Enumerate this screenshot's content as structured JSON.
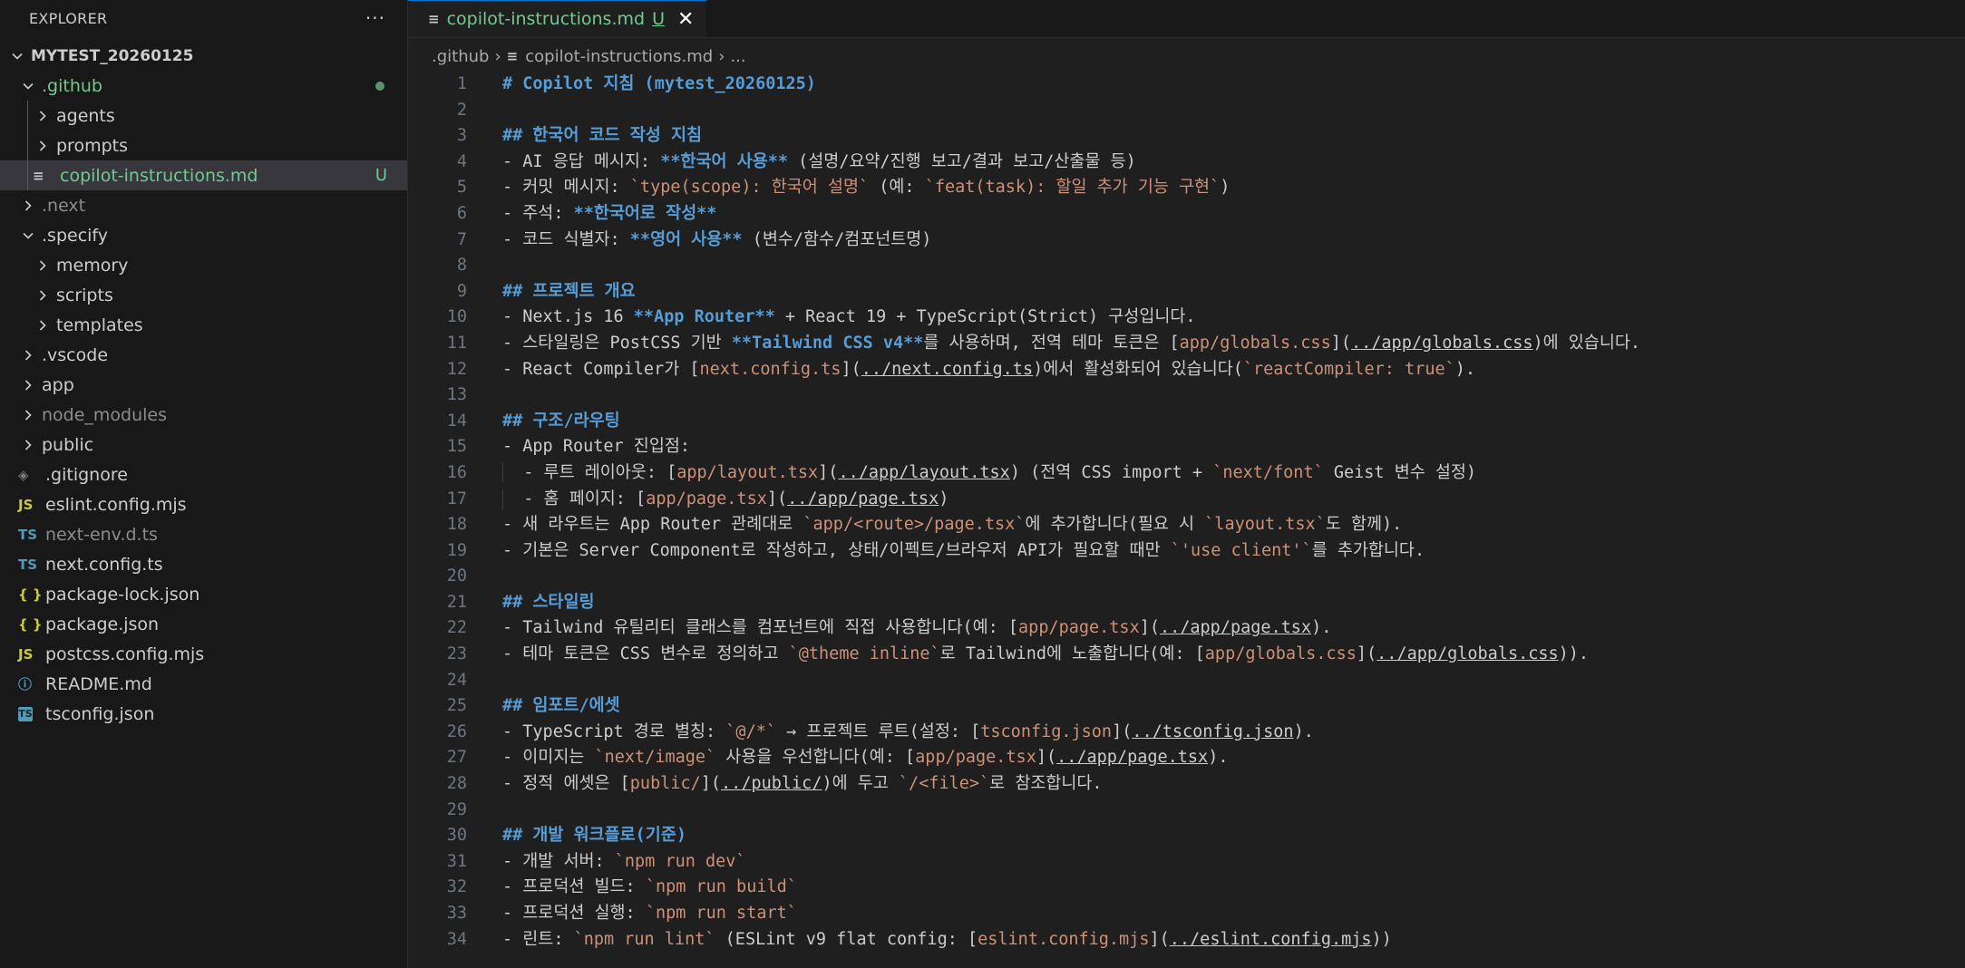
{
  "explorer": {
    "title": "EXPLORER",
    "more": "···",
    "root": "MYTEST_20260125",
    "items": [
      {
        "label": ".github",
        "kind": "folder",
        "open": true,
        "depth": 1,
        "color": "#73c991",
        "badge": "dot"
      },
      {
        "label": "agents",
        "kind": "folder",
        "open": false,
        "depth": 2,
        "color": "#cccccc"
      },
      {
        "label": "prompts",
        "kind": "folder",
        "open": false,
        "depth": 2,
        "color": "#cccccc"
      },
      {
        "label": "copilot-instructions.md",
        "kind": "file",
        "icon": "md",
        "depth": 2,
        "color": "#73c991",
        "badge": "U",
        "selected": true
      },
      {
        "label": ".next",
        "kind": "folder",
        "open": false,
        "depth": 1,
        "color": "#8c8c8c"
      },
      {
        "label": ".specify",
        "kind": "folder",
        "open": true,
        "depth": 1,
        "color": "#cccccc"
      },
      {
        "label": "memory",
        "kind": "folder",
        "open": false,
        "depth": 2,
        "color": "#cccccc"
      },
      {
        "label": "scripts",
        "kind": "folder",
        "open": false,
        "depth": 2,
        "color": "#cccccc"
      },
      {
        "label": "templates",
        "kind": "folder",
        "open": false,
        "depth": 2,
        "color": "#cccccc"
      },
      {
        "label": ".vscode",
        "kind": "folder",
        "open": false,
        "depth": 1,
        "color": "#cccccc"
      },
      {
        "label": "app",
        "kind": "folder",
        "open": false,
        "depth": 1,
        "color": "#cccccc"
      },
      {
        "label": "node_modules",
        "kind": "folder",
        "open": false,
        "depth": 1,
        "color": "#8c8c8c"
      },
      {
        "label": "public",
        "kind": "folder",
        "open": false,
        "depth": 1,
        "color": "#cccccc"
      },
      {
        "label": ".gitignore",
        "kind": "file",
        "icon": "git",
        "depth": 1,
        "color": "#cccccc"
      },
      {
        "label": "eslint.config.mjs",
        "kind": "file",
        "icon": "js",
        "depth": 1,
        "color": "#cccccc"
      },
      {
        "label": "next-env.d.ts",
        "kind": "file",
        "icon": "ts",
        "depth": 1,
        "color": "#8c8c8c"
      },
      {
        "label": "next.config.ts",
        "kind": "file",
        "icon": "ts",
        "depth": 1,
        "color": "#cccccc"
      },
      {
        "label": "package-lock.json",
        "kind": "file",
        "icon": "json",
        "depth": 1,
        "color": "#cccccc"
      },
      {
        "label": "package.json",
        "kind": "file",
        "icon": "json",
        "depth": 1,
        "color": "#cccccc"
      },
      {
        "label": "postcss.config.mjs",
        "kind": "file",
        "icon": "js",
        "depth": 1,
        "color": "#cccccc"
      },
      {
        "label": "README.md",
        "kind": "file",
        "icon": "info",
        "depth": 1,
        "color": "#cccccc"
      },
      {
        "label": "tsconfig.json",
        "kind": "file",
        "icon": "tsbox",
        "depth": 1,
        "color": "#cccccc"
      }
    ],
    "icon_glyphs": {
      "md": "≡",
      "git": "◈",
      "js": "JS",
      "ts": "TS",
      "json": "{ }",
      "info": "ⓘ",
      "tsbox": "TS"
    }
  },
  "tab": {
    "label": "copilot-instructions.md",
    "status": "U",
    "close": "✕"
  },
  "breadcrumb": [
    ".github",
    "copilot-instructions.md",
    "..."
  ],
  "code_lines": [
    [
      [
        "h",
        "# Copilot 지침 (mytest_20260125)"
      ]
    ],
    [],
    [
      [
        "h",
        "## 한국어 코드 작성 지침"
      ]
    ],
    [
      [
        "t",
        "- AI 응답 메시지: "
      ],
      [
        "b",
        "**한국어 사용**"
      ],
      [
        "t",
        " (설명/요약/진행 보고/결과 보고/산출물 등)"
      ]
    ],
    [
      [
        "t",
        "- 커밋 메시지: "
      ],
      [
        "c",
        "`type(scope): 한국어 설명`"
      ],
      [
        "t",
        " (예: "
      ],
      [
        "c",
        "`feat(task): 할일 추가 기능 구현`"
      ],
      [
        "t",
        ")"
      ]
    ],
    [
      [
        "t",
        "- 주석: "
      ],
      [
        "b",
        "**한국어로 작성**"
      ]
    ],
    [
      [
        "t",
        "- 코드 식별자: "
      ],
      [
        "b",
        "**영어 사용**"
      ],
      [
        "t",
        " (변수/함수/컴포넌트명)"
      ]
    ],
    [],
    [
      [
        "h",
        "## 프로젝트 개요"
      ]
    ],
    [
      [
        "t",
        "- Next.js 16 "
      ],
      [
        "b",
        "**App Router**"
      ],
      [
        "t",
        " + React 19 + TypeScript(Strict) 구성입니다."
      ]
    ],
    [
      [
        "t",
        "- 스타일링은 PostCSS 기반 "
      ],
      [
        "b",
        "**Tailwind CSS v4**"
      ],
      [
        "t",
        "를 사용하며, 전역 테마 토큰은 ["
      ],
      [
        "lt",
        "app/globals.css"
      ],
      [
        "t",
        "]("
      ],
      [
        "u",
        "../app/globals.css"
      ],
      [
        "t",
        ")에 있습니다."
      ]
    ],
    [
      [
        "t",
        "- React Compiler가 ["
      ],
      [
        "lt",
        "next.config.ts"
      ],
      [
        "t",
        "]("
      ],
      [
        "u",
        "../next.config.ts"
      ],
      [
        "t",
        ")에서 활성화되어 있습니다("
      ],
      [
        "c",
        "`reactCompiler: true`"
      ],
      [
        "t",
        ")."
      ]
    ],
    [],
    [
      [
        "h",
        "## 구조/라우팅"
      ]
    ],
    [
      [
        "t",
        "- App Router 진입점:"
      ]
    ],
    [
      [
        "g",
        "  "
      ],
      [
        "t",
        "- 루트 레이아웃: ["
      ],
      [
        "lt",
        "app/layout.tsx"
      ],
      [
        "t",
        "]("
      ],
      [
        "u",
        "../app/layout.tsx"
      ],
      [
        "t",
        ") (전역 CSS import + "
      ],
      [
        "c",
        "`next/font`"
      ],
      [
        "t",
        " Geist 변수 설정)"
      ]
    ],
    [
      [
        "g",
        "  "
      ],
      [
        "t",
        "- 홈 페이지: ["
      ],
      [
        "lt",
        "app/page.tsx"
      ],
      [
        "t",
        "]("
      ],
      [
        "u",
        "../app/page.tsx"
      ],
      [
        "t",
        ")"
      ]
    ],
    [
      [
        "t",
        "- 새 라우트는 App Router 관례대로 "
      ],
      [
        "c",
        "`app/<route>/page.tsx`"
      ],
      [
        "t",
        "에 추가합니다(필요 시 "
      ],
      [
        "c",
        "`layout.tsx`"
      ],
      [
        "t",
        "도 함께)."
      ]
    ],
    [
      [
        "t",
        "- 기본은 Server Component로 작성하고, 상태/이펙트/브라우저 API가 필요할 때만 "
      ],
      [
        "c",
        "`'use client'`"
      ],
      [
        "t",
        "를 추가합니다."
      ]
    ],
    [],
    [
      [
        "h",
        "## 스타일링"
      ]
    ],
    [
      [
        "t",
        "- Tailwind 유틸리티 클래스를 컴포넌트에 직접 사용합니다(예: ["
      ],
      [
        "lt",
        "app/page.tsx"
      ],
      [
        "t",
        "]("
      ],
      [
        "u",
        "../app/page.tsx"
      ],
      [
        "t",
        ")."
      ]
    ],
    [
      [
        "t",
        "- 테마 토큰은 CSS 변수로 정의하고 "
      ],
      [
        "c",
        "`@theme inline`"
      ],
      [
        "t",
        "로 Tailwind에 노출합니다(예: ["
      ],
      [
        "lt",
        "app/globals.css"
      ],
      [
        "t",
        "]("
      ],
      [
        "u",
        "../app/globals.css"
      ],
      [
        "t",
        "))."
      ]
    ],
    [],
    [
      [
        "h",
        "## 임포트/에셋"
      ]
    ],
    [
      [
        "t",
        "- TypeScript 경로 별칭: "
      ],
      [
        "c",
        "`@/*`"
      ],
      [
        "t",
        " → 프로젝트 루트(설정: ["
      ],
      [
        "lt",
        "tsconfig.json"
      ],
      [
        "t",
        "]("
      ],
      [
        "u",
        "../tsconfig.json"
      ],
      [
        "t",
        ")."
      ]
    ],
    [
      [
        "t",
        "- 이미지는 "
      ],
      [
        "c",
        "`next/image`"
      ],
      [
        "t",
        " 사용을 우선합니다(예: ["
      ],
      [
        "lt",
        "app/page.tsx"
      ],
      [
        "t",
        "]("
      ],
      [
        "u",
        "../app/page.tsx"
      ],
      [
        "t",
        ")."
      ]
    ],
    [
      [
        "t",
        "- 정적 에셋은 ["
      ],
      [
        "lt",
        "public/"
      ],
      [
        "t",
        "]("
      ],
      [
        "u",
        "../public/"
      ],
      [
        "t",
        ")에 두고 "
      ],
      [
        "c",
        "`/<file>`"
      ],
      [
        "t",
        "로 참조합니다."
      ]
    ],
    [],
    [
      [
        "h",
        "## 개발 워크플로(기준)"
      ]
    ],
    [
      [
        "t",
        "- 개발 서버: "
      ],
      [
        "c",
        "`npm run dev`"
      ]
    ],
    [
      [
        "t",
        "- 프로덕션 빌드: "
      ],
      [
        "c",
        "`npm run build`"
      ]
    ],
    [
      [
        "t",
        "- 프로덕션 실행: "
      ],
      [
        "c",
        "`npm run start`"
      ]
    ],
    [
      [
        "t",
        "- 린트: "
      ],
      [
        "c",
        "`npm run lint`"
      ],
      [
        "t",
        " (ESLint v9 flat config: ["
      ],
      [
        "lt",
        "eslint.config.mjs"
      ],
      [
        "t",
        "]("
      ],
      [
        "u",
        "../eslint.config.mjs"
      ],
      [
        "t",
        "))"
      ]
    ]
  ]
}
